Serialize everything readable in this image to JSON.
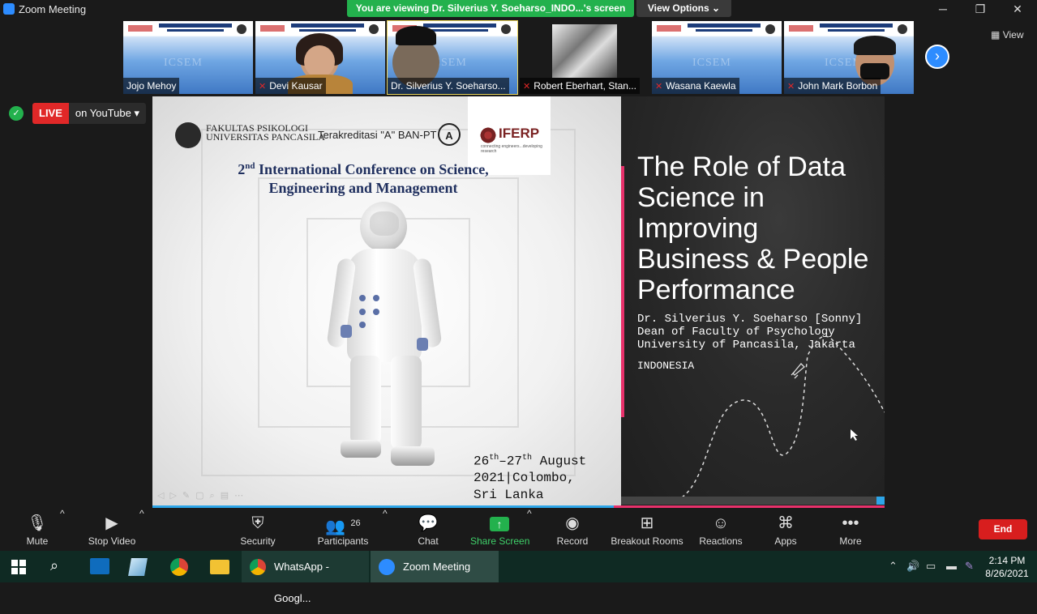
{
  "window": {
    "title": "Zoom Meeting"
  },
  "banner": {
    "viewing": "You are viewing Dr. Silverius Y. Soeharso_INDO...'s screen",
    "view_options": "View Options"
  },
  "window_controls": [
    "─",
    "❐",
    "✕"
  ],
  "participants_strip": {
    "view_label": "View",
    "tiles": [
      {
        "name": "Jojo Mehoy",
        "muted": false
      },
      {
        "name": "Devi Kausar",
        "muted": true
      },
      {
        "name": "Dr. Silverius Y. Soeharso...",
        "muted": false
      },
      {
        "name": "Robert Eberhart, Stan...",
        "muted": true
      },
      {
        "name": "Wasana Kaewla",
        "muted": true
      },
      {
        "name": "John Mark Borbon",
        "muted": true
      }
    ],
    "poster_watermark": "ICSEM"
  },
  "live": {
    "tag": "LIVE",
    "platform": "on YouTube"
  },
  "slide_left": {
    "faculty_line1": "FAKULTAS PSIKOLOGI",
    "faculty_line2": "UNIVERSITAS PANCASILA",
    "accreditation": "Terakreditasi \"A\" BAN-PT",
    "badge": "A",
    "iferp": "IFERP",
    "iferp_sub": "connecting engineers...developing research",
    "conference_ordinal": "2",
    "conference_sup": "nd",
    "conference_line1": " International Conference on Science,",
    "conference_line2": "Engineering and Management",
    "date_line1_a": "26",
    "date_line1_b": "th",
    "date_line1_c": "–27",
    "date_line1_d": "th",
    "date_line1_e": " August",
    "date_line2": "2021|Colombo,",
    "date_line3": "Sri Lanka"
  },
  "slide_right": {
    "title_lines": [
      "The Role of Data",
      "Science in",
      "Improving",
      "Business & People",
      "Performance"
    ],
    "speaker_lines": [
      "Dr. Silverius Y. Soeharso [Sonny]",
      "Dean of Faculty of Psychology",
      "University of Pancasila, Jakarta"
    ],
    "country": "INDONESIA"
  },
  "toolbar": {
    "mute": "Mute",
    "stop_video": "Stop Video",
    "security": "Security",
    "participants": "Participants",
    "participants_count": "26",
    "chat": "Chat",
    "share_screen": "Share Screen",
    "record": "Record",
    "breakout_rooms": "Breakout Rooms",
    "reactions": "Reactions",
    "apps": "Apps",
    "more": "More",
    "end": "End"
  },
  "taskbar": {
    "apps": [
      {
        "name": "WhatsApp - Googl...",
        "icon": "chrome-icon"
      },
      {
        "name": "Zoom Meeting",
        "icon": "zoom-icon"
      }
    ],
    "time": "2:14 PM",
    "date": "8/26/2021"
  },
  "colors": {
    "zoom_blue": "#2d8cff",
    "banner_green": "#23b14d",
    "end_red": "#d81e1e",
    "accent_pink": "#e8316b"
  }
}
